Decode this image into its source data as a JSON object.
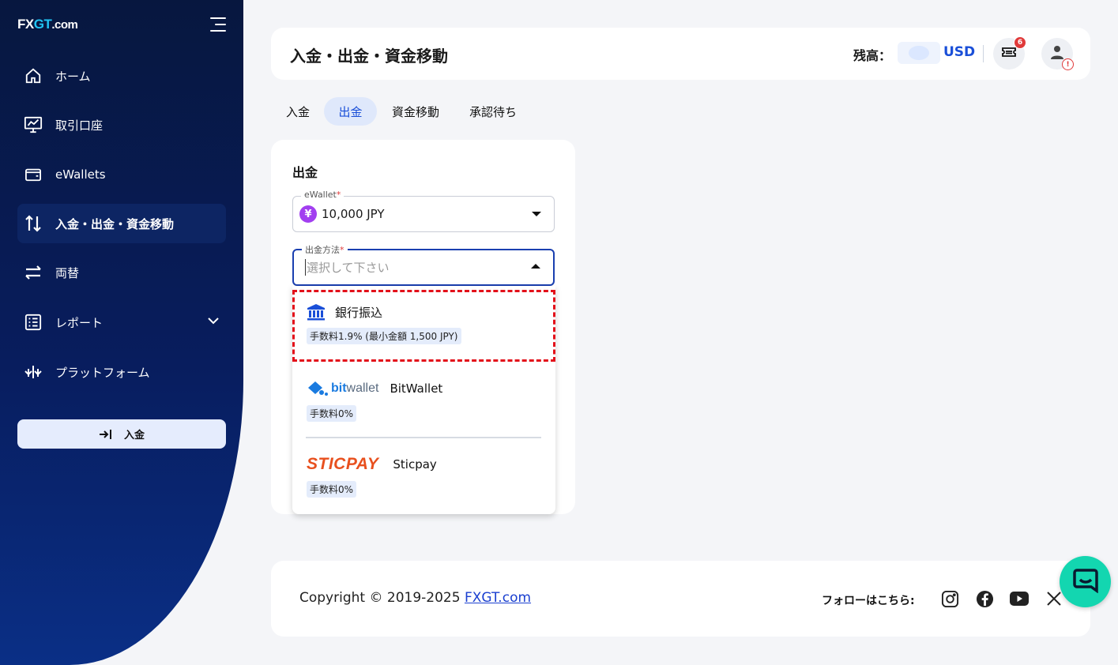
{
  "brand": {
    "logo_part1": "FX",
    "logo_part2": "GT",
    "logo_part3": ".com"
  },
  "sidebar": {
    "items": [
      {
        "label": "ホーム",
        "icon": "home-icon"
      },
      {
        "label": "取引口座",
        "icon": "chart-monitor-icon"
      },
      {
        "label": "eWallets",
        "icon": "wallet-icon"
      },
      {
        "label": "入金・出金・資金移動",
        "icon": "transfer-arrows-icon",
        "active": true
      },
      {
        "label": "両替",
        "icon": "exchange-icon"
      },
      {
        "label": "レポート",
        "icon": "report-list-icon"
      },
      {
        "label": "プラットフォーム",
        "icon": "platform-icon"
      }
    ],
    "deposit_button": "入金"
  },
  "header": {
    "title": "入金・出金・資金移動",
    "balance_label": "残高：",
    "balance_currency": "USD",
    "notification_count": "6",
    "warning_mark": "!"
  },
  "tabs": [
    {
      "label": "入金"
    },
    {
      "label": "出金",
      "active": true
    },
    {
      "label": "資金移動"
    },
    {
      "label": "承認待ち"
    }
  ],
  "withdraw": {
    "title": "出金",
    "ewallet_label": "eWallet",
    "ewallet_value": "10,000 JPY",
    "currency_symbol": "¥",
    "method_label": "出金方法",
    "method_placeholder": "選択して下さい",
    "required_mark": "*",
    "options": [
      {
        "name": "銀行振込",
        "fee": "手数料1.9% (最小金額 1,500 JPY)",
        "icon": "bank-icon"
      },
      {
        "name": "BitWallet",
        "fee": "手数料0%",
        "logo_text_1": "bit",
        "logo_text_2": "wallet"
      },
      {
        "name": "Sticpay",
        "fee": "手数料0%",
        "logo_text": "STICPAY"
      }
    ]
  },
  "footer": {
    "copyright_prefix": "Copyright © 2019-2025 ",
    "copyright_link": "FXGT.com",
    "follow_label": "フォローはこちら:"
  },
  "colors": {
    "accent": "#1a4fd8",
    "sidebar": "#07173f",
    "highlight": "#e3101a",
    "chat": "#13d6b0"
  }
}
